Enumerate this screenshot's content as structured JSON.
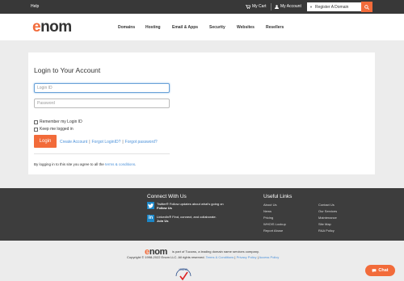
{
  "topbar": {
    "help": "Help",
    "cart": "My Cart",
    "account": "My Account",
    "register": "Register A Domain"
  },
  "header": {
    "logo": "enom",
    "nav": [
      "Domains",
      "Hosting",
      "Email & Apps",
      "Security",
      "Websites",
      "Resellers"
    ]
  },
  "login": {
    "title": "Login to Your Account",
    "login_id_placeholder": "Login ID",
    "password_placeholder": "Password",
    "remember": "Remember my Login ID",
    "keep": "Keep me logged in",
    "button": "Login",
    "create": "Create Account",
    "forgot_id": "Forgot LoginID?",
    "forgot_pw": "Forgot password?",
    "terms_prefix": "By logging in to this site you agree to all the ",
    "terms_link": "terms & conditions",
    "terms_suffix": "."
  },
  "footer": {
    "connect_title": "Connect With Us",
    "twitter_text": "Twitter® Follow updates about what's going on",
    "twitter_link": "Follow Us",
    "linkedin_text": "LinkedIn® Find, connect, and collaborate.",
    "linkedin_link": "Join Us",
    "useful_title": "Useful Links",
    "col1": [
      "About Us",
      "News",
      "Pricing",
      "WHOIS Lookup",
      "Report Abuse"
    ],
    "col2": [
      "Contact Us",
      "Our Services",
      "Maintenance",
      "Site Map",
      "RAA Policy"
    ]
  },
  "bottom": {
    "logo": "enom",
    "line1": "is part of Tucows, a leading domain name services company.",
    "copyright": "Copyright © 1998-2022 Enom LLC. All rights reserved.",
    "tc": "Terms & Conditions",
    "privacy": "Privacy Policy",
    "access": "Access Policy"
  },
  "chat": {
    "label": "Chat"
  },
  "colors": {
    "accent": "#f26b3a",
    "link": "#4a90d9",
    "footer": "#3d3d3d"
  }
}
